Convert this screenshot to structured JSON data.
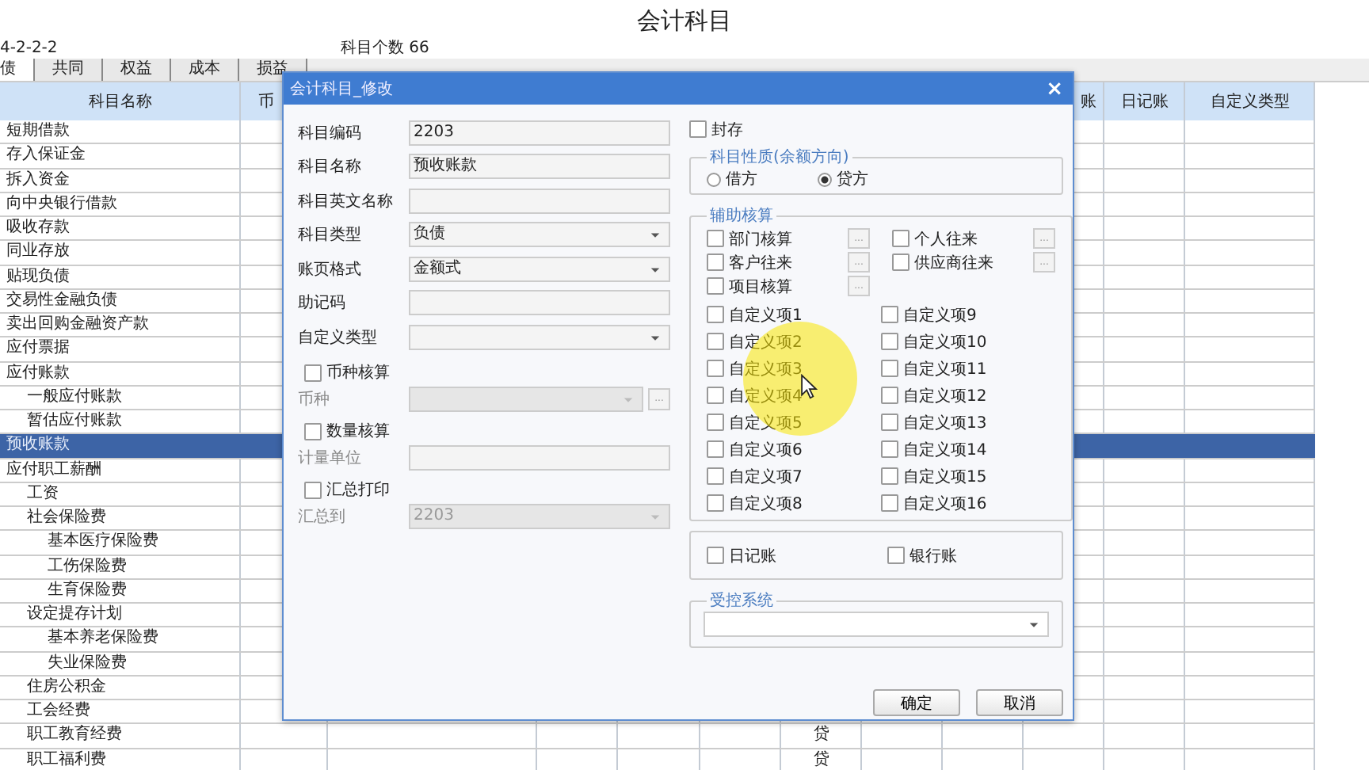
{
  "page_title": "会计科目",
  "code_rule": "4-2-2-2",
  "count_label": "科目个数",
  "count": "66",
  "tabs": [
    {
      "label": "债",
      "selected": true
    },
    {
      "label": "共同",
      "selected": false
    },
    {
      "label": "权益",
      "selected": false
    },
    {
      "label": "成本",
      "selected": false
    },
    {
      "label": "损益",
      "selected": false
    }
  ],
  "table": {
    "columns": [
      {
        "label": "科目名称"
      },
      {
        "label": "币"
      },
      {
        "label": "账"
      },
      {
        "label": "日记账"
      },
      {
        "label": "自定义类型"
      }
    ],
    "rows": [
      {
        "name": "短期借款",
        "selected": false
      },
      {
        "name": "存入保证金",
        "selected": false
      },
      {
        "name": "拆入资金",
        "selected": false
      },
      {
        "name": "向中央银行借款",
        "selected": false
      },
      {
        "name": "吸收存款",
        "selected": false
      },
      {
        "name": "同业存放",
        "selected": false
      },
      {
        "name": "贴现负债",
        "selected": false
      },
      {
        "name": "交易性金融负债",
        "selected": false
      },
      {
        "name": "卖出回购金融资产款",
        "selected": false
      },
      {
        "name": "应付票据",
        "selected": false
      },
      {
        "name": "应付账款",
        "selected": false,
        "children": [
          {
            "name": "一般应付账款",
            "selected": false
          },
          {
            "name": "暂估应付账款",
            "selected": false
          }
        ]
      },
      {
        "name": "预收账款",
        "selected": true
      },
      {
        "name": "应付职工薪酬",
        "selected": false,
        "children": [
          {
            "name": "工资",
            "selected": false
          },
          {
            "name": "社会保险费",
            "selected": false,
            "children": [
              {
                "name": "基本医疗保险费",
                "selected": false
              },
              {
                "name": "工伤保险费",
                "selected": false
              },
              {
                "name": "生育保险费",
                "selected": false
              }
            ]
          },
          {
            "name": "设定提存计划",
            "selected": false,
            "children": [
              {
                "name": "基本养老保险费",
                "selected": false
              },
              {
                "name": "失业保险费",
                "selected": false
              }
            ]
          },
          {
            "name": "住房公积金",
            "selected": false
          },
          {
            "name": "工会经费",
            "selected": false
          },
          {
            "name": "职工教育经费",
            "selected": false,
            "direction": "贷"
          },
          {
            "name": "职工福利费",
            "selected": false,
            "direction": "贷"
          }
        ]
      }
    ]
  },
  "dialog": {
    "title": "会计科目_修改",
    "close": "×",
    "fields": [
      {
        "kind": "text",
        "label": "科目编码",
        "value": "2203"
      },
      {
        "kind": "text",
        "label": "科目名称",
        "value": "预收账款"
      },
      {
        "kind": "text",
        "label": "科目英文名称"
      },
      {
        "kind": "select",
        "label": "科目类型",
        "value": "负债"
      },
      {
        "kind": "select",
        "label": "账页格式",
        "value": "金额式"
      },
      {
        "kind": "text",
        "label": "助记码"
      },
      {
        "kind": "select",
        "label": "自定义类型"
      }
    ],
    "options": [
      {
        "check": "币种核算",
        "checked": false,
        "label": "币种",
        "kind": "select_more",
        "disabled": true,
        "button": "..."
      },
      {
        "check": "数量核算",
        "checked": false,
        "label": "计量单位",
        "kind": "text",
        "disabled": false
      },
      {
        "check": "汇总打印",
        "checked": false,
        "label": "汇总到",
        "kind": "select",
        "disabled": true,
        "value": "2203"
      }
    ],
    "sealed": {
      "label": "封存",
      "checked": false
    },
    "balance_direction": {
      "legend": "科目性质(余额方向)",
      "choices": [
        {
          "label": "借方",
          "selected": false
        },
        {
          "label": "贷方",
          "selected": true
        }
      ]
    },
    "auxiliary": {
      "legend": "辅助核算",
      "items": [
        {
          "label": "部门核算",
          "checked": false,
          "button": "..."
        },
        {
          "label": "个人往来",
          "checked": false,
          "button": "..."
        },
        {
          "label": "客户往来",
          "checked": false,
          "button": "..."
        },
        {
          "label": "供应商往来",
          "checked": false,
          "button": "..."
        },
        {
          "label": "项目核算",
          "checked": false,
          "button": "..."
        }
      ],
      "custom_left": [
        {
          "label": "自定义项1",
          "checked": false
        },
        {
          "label": "自定义项2",
          "checked": false
        },
        {
          "label": "自定义项3",
          "checked": false
        },
        {
          "label": "自定义项4",
          "checked": false
        },
        {
          "label": "自定义项5",
          "checked": false
        },
        {
          "label": "自定义项6",
          "checked": false
        },
        {
          "label": "自定义项7",
          "checked": false
        },
        {
          "label": "自定义项8",
          "checked": false
        }
      ],
      "custom_right": [
        {
          "label": "自定义项9",
          "checked": false
        },
        {
          "label": "自定义项10",
          "checked": false
        },
        {
          "label": "自定义项11",
          "checked": false
        },
        {
          "label": "自定义项12",
          "checked": false
        },
        {
          "label": "自定义项13",
          "checked": false
        },
        {
          "label": "自定义项14",
          "checked": false
        },
        {
          "label": "自定义项15",
          "checked": false
        },
        {
          "label": "自定义项16",
          "checked": false
        }
      ]
    },
    "ledgers": [
      {
        "label": "日记账",
        "checked": false
      },
      {
        "label": "银行账",
        "checked": false
      }
    ],
    "controlled_system": {
      "legend": "受控系统"
    },
    "buttons": [
      "确定",
      "取消"
    ]
  }
}
